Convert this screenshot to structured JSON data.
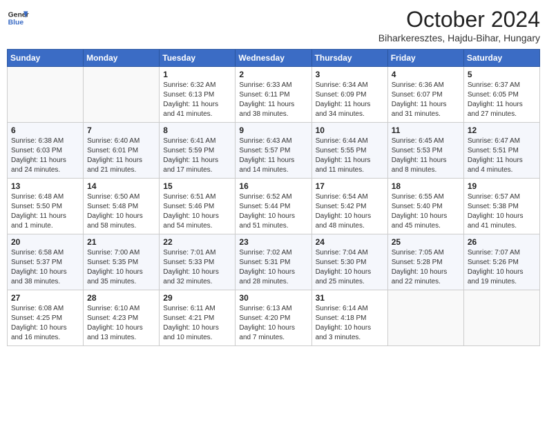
{
  "header": {
    "logo_line1": "General",
    "logo_line2": "Blue",
    "month_title": "October 2024",
    "location": "Biharkeresztes, Hajdu-Bihar, Hungary"
  },
  "weekdays": [
    "Sunday",
    "Monday",
    "Tuesday",
    "Wednesday",
    "Thursday",
    "Friday",
    "Saturday"
  ],
  "weeks": [
    [
      {
        "day": "",
        "sunrise": "",
        "sunset": "",
        "daylight": ""
      },
      {
        "day": "",
        "sunrise": "",
        "sunset": "",
        "daylight": ""
      },
      {
        "day": "1",
        "sunrise": "Sunrise: 6:32 AM",
        "sunset": "Sunset: 6:13 PM",
        "daylight": "Daylight: 11 hours and 41 minutes."
      },
      {
        "day": "2",
        "sunrise": "Sunrise: 6:33 AM",
        "sunset": "Sunset: 6:11 PM",
        "daylight": "Daylight: 11 hours and 38 minutes."
      },
      {
        "day": "3",
        "sunrise": "Sunrise: 6:34 AM",
        "sunset": "Sunset: 6:09 PM",
        "daylight": "Daylight: 11 hours and 34 minutes."
      },
      {
        "day": "4",
        "sunrise": "Sunrise: 6:36 AM",
        "sunset": "Sunset: 6:07 PM",
        "daylight": "Daylight: 11 hours and 31 minutes."
      },
      {
        "day": "5",
        "sunrise": "Sunrise: 6:37 AM",
        "sunset": "Sunset: 6:05 PM",
        "daylight": "Daylight: 11 hours and 27 minutes."
      }
    ],
    [
      {
        "day": "6",
        "sunrise": "Sunrise: 6:38 AM",
        "sunset": "Sunset: 6:03 PM",
        "daylight": "Daylight: 11 hours and 24 minutes."
      },
      {
        "day": "7",
        "sunrise": "Sunrise: 6:40 AM",
        "sunset": "Sunset: 6:01 PM",
        "daylight": "Daylight: 11 hours and 21 minutes."
      },
      {
        "day": "8",
        "sunrise": "Sunrise: 6:41 AM",
        "sunset": "Sunset: 5:59 PM",
        "daylight": "Daylight: 11 hours and 17 minutes."
      },
      {
        "day": "9",
        "sunrise": "Sunrise: 6:43 AM",
        "sunset": "Sunset: 5:57 PM",
        "daylight": "Daylight: 11 hours and 14 minutes."
      },
      {
        "day": "10",
        "sunrise": "Sunrise: 6:44 AM",
        "sunset": "Sunset: 5:55 PM",
        "daylight": "Daylight: 11 hours and 11 minutes."
      },
      {
        "day": "11",
        "sunrise": "Sunrise: 6:45 AM",
        "sunset": "Sunset: 5:53 PM",
        "daylight": "Daylight: 11 hours and 8 minutes."
      },
      {
        "day": "12",
        "sunrise": "Sunrise: 6:47 AM",
        "sunset": "Sunset: 5:51 PM",
        "daylight": "Daylight: 11 hours and 4 minutes."
      }
    ],
    [
      {
        "day": "13",
        "sunrise": "Sunrise: 6:48 AM",
        "sunset": "Sunset: 5:50 PM",
        "daylight": "Daylight: 11 hours and 1 minute."
      },
      {
        "day": "14",
        "sunrise": "Sunrise: 6:50 AM",
        "sunset": "Sunset: 5:48 PM",
        "daylight": "Daylight: 10 hours and 58 minutes."
      },
      {
        "day": "15",
        "sunrise": "Sunrise: 6:51 AM",
        "sunset": "Sunset: 5:46 PM",
        "daylight": "Daylight: 10 hours and 54 minutes."
      },
      {
        "day": "16",
        "sunrise": "Sunrise: 6:52 AM",
        "sunset": "Sunset: 5:44 PM",
        "daylight": "Daylight: 10 hours and 51 minutes."
      },
      {
        "day": "17",
        "sunrise": "Sunrise: 6:54 AM",
        "sunset": "Sunset: 5:42 PM",
        "daylight": "Daylight: 10 hours and 48 minutes."
      },
      {
        "day": "18",
        "sunrise": "Sunrise: 6:55 AM",
        "sunset": "Sunset: 5:40 PM",
        "daylight": "Daylight: 10 hours and 45 minutes."
      },
      {
        "day": "19",
        "sunrise": "Sunrise: 6:57 AM",
        "sunset": "Sunset: 5:38 PM",
        "daylight": "Daylight: 10 hours and 41 minutes."
      }
    ],
    [
      {
        "day": "20",
        "sunrise": "Sunrise: 6:58 AM",
        "sunset": "Sunset: 5:37 PM",
        "daylight": "Daylight: 10 hours and 38 minutes."
      },
      {
        "day": "21",
        "sunrise": "Sunrise: 7:00 AM",
        "sunset": "Sunset: 5:35 PM",
        "daylight": "Daylight: 10 hours and 35 minutes."
      },
      {
        "day": "22",
        "sunrise": "Sunrise: 7:01 AM",
        "sunset": "Sunset: 5:33 PM",
        "daylight": "Daylight: 10 hours and 32 minutes."
      },
      {
        "day": "23",
        "sunrise": "Sunrise: 7:02 AM",
        "sunset": "Sunset: 5:31 PM",
        "daylight": "Daylight: 10 hours and 28 minutes."
      },
      {
        "day": "24",
        "sunrise": "Sunrise: 7:04 AM",
        "sunset": "Sunset: 5:30 PM",
        "daylight": "Daylight: 10 hours and 25 minutes."
      },
      {
        "day": "25",
        "sunrise": "Sunrise: 7:05 AM",
        "sunset": "Sunset: 5:28 PM",
        "daylight": "Daylight: 10 hours and 22 minutes."
      },
      {
        "day": "26",
        "sunrise": "Sunrise: 7:07 AM",
        "sunset": "Sunset: 5:26 PM",
        "daylight": "Daylight: 10 hours and 19 minutes."
      }
    ],
    [
      {
        "day": "27",
        "sunrise": "Sunrise: 6:08 AM",
        "sunset": "Sunset: 4:25 PM",
        "daylight": "Daylight: 10 hours and 16 minutes."
      },
      {
        "day": "28",
        "sunrise": "Sunrise: 6:10 AM",
        "sunset": "Sunset: 4:23 PM",
        "daylight": "Daylight: 10 hours and 13 minutes."
      },
      {
        "day": "29",
        "sunrise": "Sunrise: 6:11 AM",
        "sunset": "Sunset: 4:21 PM",
        "daylight": "Daylight: 10 hours and 10 minutes."
      },
      {
        "day": "30",
        "sunrise": "Sunrise: 6:13 AM",
        "sunset": "Sunset: 4:20 PM",
        "daylight": "Daylight: 10 hours and 7 minutes."
      },
      {
        "day": "31",
        "sunrise": "Sunrise: 6:14 AM",
        "sunset": "Sunset: 4:18 PM",
        "daylight": "Daylight: 10 hours and 3 minutes."
      },
      {
        "day": "",
        "sunrise": "",
        "sunset": "",
        "daylight": ""
      },
      {
        "day": "",
        "sunrise": "",
        "sunset": "",
        "daylight": ""
      }
    ]
  ]
}
